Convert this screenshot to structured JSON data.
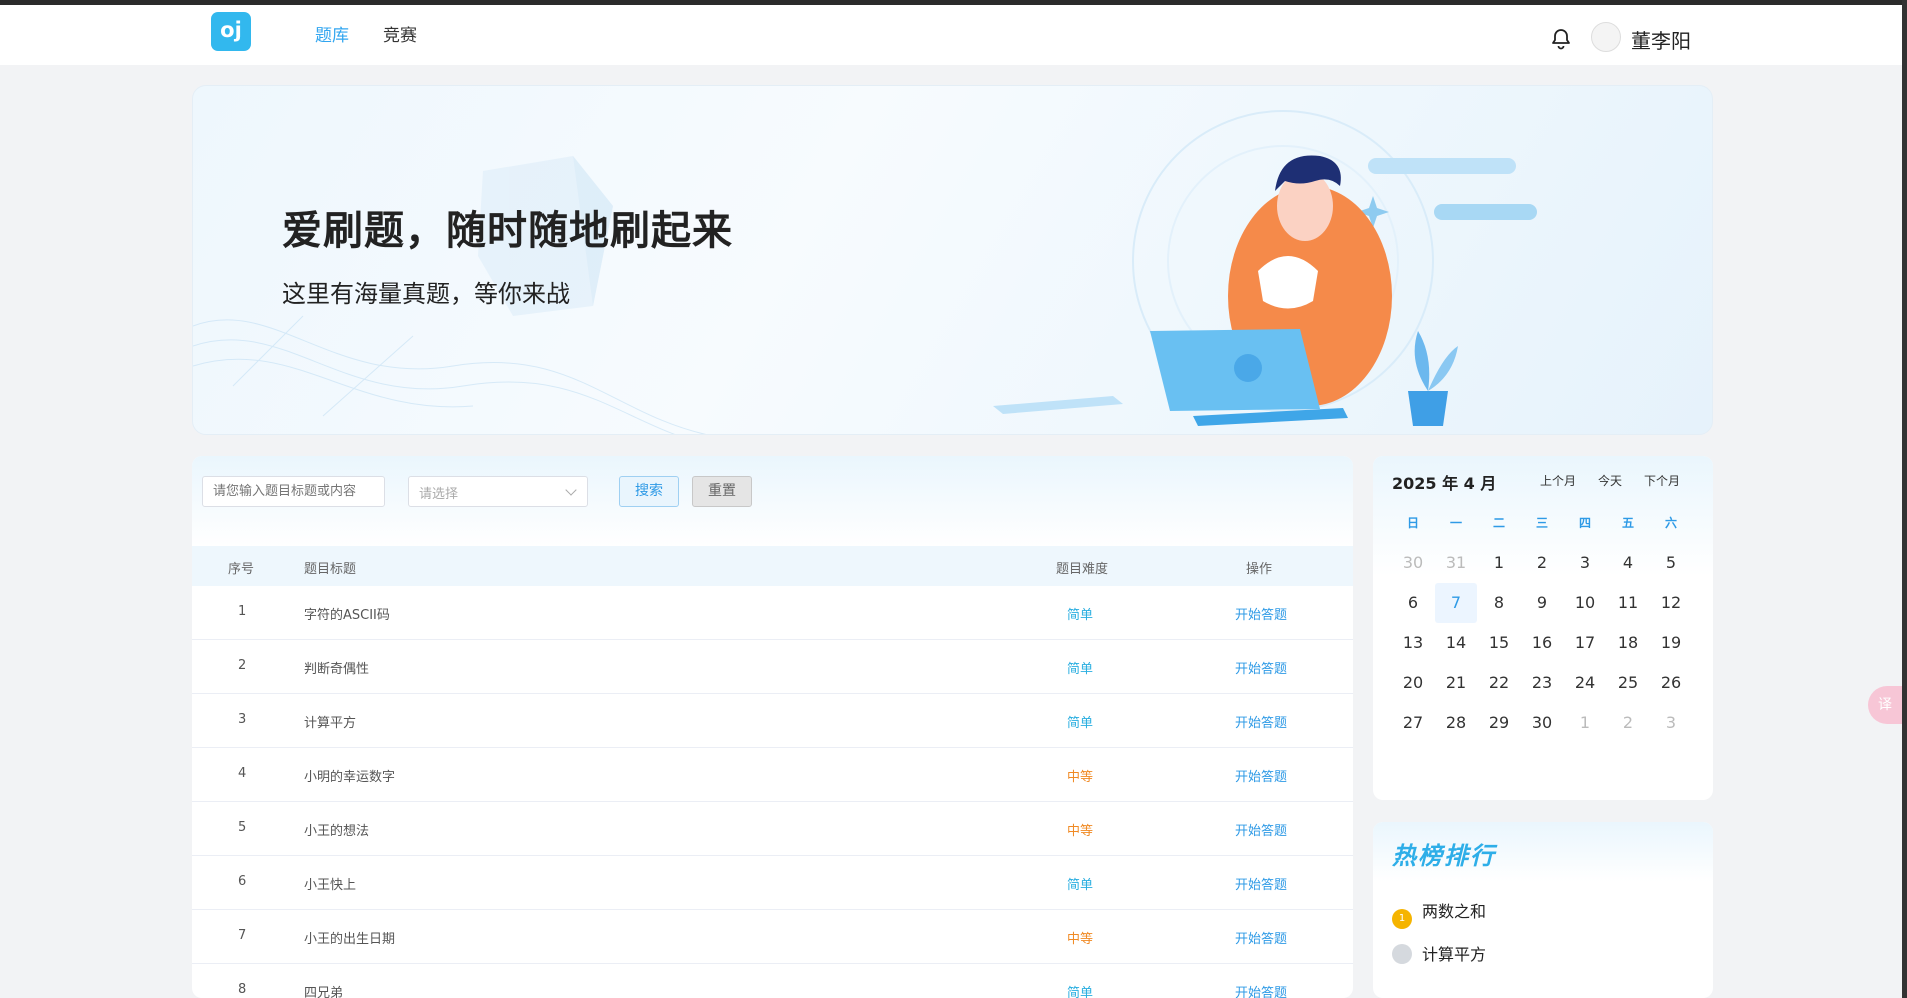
{
  "header": {
    "logo_text": "oj",
    "nav": [
      {
        "label": "题库",
        "active": true
      },
      {
        "label": "竞赛",
        "active": false
      }
    ],
    "username": "董李阳",
    "bell_icon": "bell-icon",
    "accent_color": "#32a6f0"
  },
  "banner": {
    "title": "爱刷题，随时随地刷起来",
    "subtitle": "这里有海量真题，等你来战"
  },
  "filters": {
    "search_placeholder": "请您输入题目标题或内容",
    "select_placeholder": "请选择",
    "search_label": "搜索",
    "reset_label": "重置"
  },
  "table": {
    "headers": {
      "index": "序号",
      "title": "题目标题",
      "difficulty": "题目难度",
      "action": "操作"
    },
    "rows": [
      {
        "index": "1",
        "title": "字符的ASCII码",
        "difficulty": "简单",
        "level": "easy",
        "action": "开始答题"
      },
      {
        "index": "2",
        "title": "判断奇偶性",
        "difficulty": "简单",
        "level": "easy",
        "action": "开始答题"
      },
      {
        "index": "3",
        "title": "计算平方",
        "difficulty": "简单",
        "level": "easy",
        "action": "开始答题"
      },
      {
        "index": "4",
        "title": "小明的幸运数字",
        "difficulty": "中等",
        "level": "medium",
        "action": "开始答题"
      },
      {
        "index": "5",
        "title": "小王的想法",
        "difficulty": "中等",
        "level": "medium",
        "action": "开始答题"
      },
      {
        "index": "6",
        "title": "小王快上",
        "difficulty": "简单",
        "level": "easy",
        "action": "开始答题"
      },
      {
        "index": "7",
        "title": "小王的出生日期",
        "difficulty": "中等",
        "level": "medium",
        "action": "开始答题"
      },
      {
        "index": "8",
        "title": "四兄弟",
        "difficulty": "简单",
        "level": "easy",
        "action": "开始答题"
      }
    ],
    "easy_color": "#29aee0",
    "medium_color": "#f08a24"
  },
  "calendar": {
    "title": "2025 年 4 月",
    "prev_label": "上个月",
    "today_label": "今天",
    "next_label": "下个月",
    "weekdays": [
      "日",
      "一",
      "二",
      "三",
      "四",
      "五",
      "六"
    ],
    "weeks": [
      [
        {
          "d": "30",
          "o": true
        },
        {
          "d": "31",
          "o": true
        },
        {
          "d": "1"
        },
        {
          "d": "2"
        },
        {
          "d": "3"
        },
        {
          "d": "4"
        },
        {
          "d": "5"
        }
      ],
      [
        {
          "d": "6"
        },
        {
          "d": "7",
          "today": true
        },
        {
          "d": "8"
        },
        {
          "d": "9"
        },
        {
          "d": "10"
        },
        {
          "d": "11"
        },
        {
          "d": "12"
        }
      ],
      [
        {
          "d": "13"
        },
        {
          "d": "14"
        },
        {
          "d": "15"
        },
        {
          "d": "16"
        },
        {
          "d": "17"
        },
        {
          "d": "18"
        },
        {
          "d": "19"
        }
      ],
      [
        {
          "d": "20"
        },
        {
          "d": "21"
        },
        {
          "d": "22"
        },
        {
          "d": "23"
        },
        {
          "d": "24"
        },
        {
          "d": "25"
        },
        {
          "d": "26"
        }
      ],
      [
        {
          "d": "27"
        },
        {
          "d": "28"
        },
        {
          "d": "29"
        },
        {
          "d": "30"
        },
        {
          "d": "1",
          "o": true
        },
        {
          "d": "2",
          "o": true
        },
        {
          "d": "3",
          "o": true
        }
      ]
    ]
  },
  "hot": {
    "title": "热榜排行",
    "items": [
      {
        "rank": "1",
        "label": "两数之和",
        "medal_color": "#f5b400"
      },
      {
        "rank": "",
        "label": "计算平方",
        "medal_color": "#d5d9de"
      }
    ]
  },
  "edge_widget": "译"
}
